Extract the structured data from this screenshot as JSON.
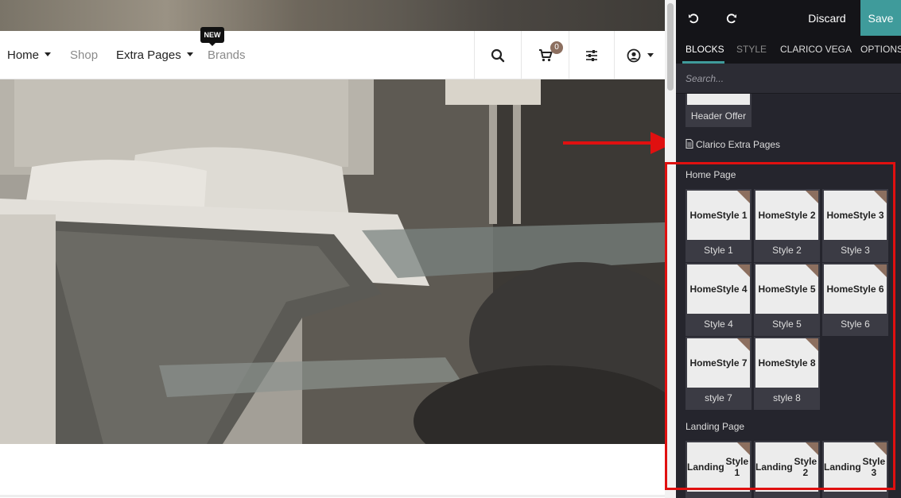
{
  "navbar": {
    "home": "Home",
    "shop": "Shop",
    "extra_pages": "Extra Pages",
    "brands": "Brands",
    "new_badge": "NEW",
    "cart_count": "0"
  },
  "editor": {
    "discard_label": "Discard",
    "save_label": "Save",
    "tabs": [
      "BLOCKS",
      "STYLE",
      "CLARICO VEGA",
      "OPTIONS"
    ],
    "search_placeholder": "Search...",
    "header_offer_label": "Header Offer",
    "category_label": "Clarico Extra Pages",
    "sections": {
      "home_page": {
        "title": "Home Page",
        "items": [
          {
            "thumb": "Home Style 1",
            "caption": "Style 1"
          },
          {
            "thumb": "Home Style 2",
            "caption": "Style 2"
          },
          {
            "thumb": "Home Style 3",
            "caption": "Style 3"
          },
          {
            "thumb": "Home Style 4",
            "caption": "Style 4"
          },
          {
            "thumb": "Home Style 5",
            "caption": "Style 5"
          },
          {
            "thumb": "Home Style 6",
            "caption": "Style 6"
          },
          {
            "thumb": "Home Style 7",
            "caption": "style 7"
          },
          {
            "thumb": "Home Style 8",
            "caption": "style 8"
          }
        ]
      },
      "landing_page": {
        "title": "Landing Page",
        "items": [
          {
            "thumb": "Landing Style 1"
          },
          {
            "thumb": "Landing Style 2"
          },
          {
            "thumb": "Landing Style 3"
          }
        ]
      }
    }
  },
  "colors": {
    "accent": "#3f9b9b",
    "highlight": "#e01010",
    "badge": "#8c6f5f"
  }
}
